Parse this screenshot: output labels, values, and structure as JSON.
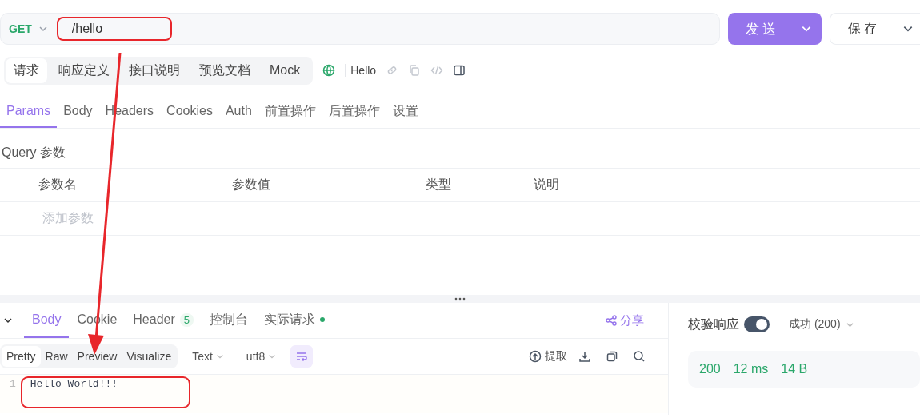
{
  "request": {
    "method": "GET",
    "url": "/hello",
    "send": "发送",
    "save": "保存"
  },
  "doc_tabs": [
    {
      "label": "请求",
      "selected": true
    },
    {
      "label": "响应定义",
      "selected": false
    },
    {
      "label": "接口说明",
      "selected": false
    },
    {
      "label": "预览文档",
      "selected": false
    },
    {
      "label": "Mock",
      "selected": false
    }
  ],
  "endpoint_name": "Hello",
  "param_tabs": [
    {
      "label": "Params",
      "selected": true
    },
    {
      "label": "Body",
      "selected": false
    },
    {
      "label": "Headers",
      "selected": false
    },
    {
      "label": "Cookies",
      "selected": false
    },
    {
      "label": "Auth",
      "selected": false
    },
    {
      "label": "前置操作",
      "selected": false
    },
    {
      "label": "后置操作",
      "selected": false
    },
    {
      "label": "设置",
      "selected": false
    }
  ],
  "query": {
    "title": "Query 参数",
    "columns": [
      "参数名",
      "参数值",
      "类型",
      "说明"
    ],
    "placeholder": "添加参数"
  },
  "response_tabs": [
    {
      "label": "Body",
      "selected": true
    },
    {
      "label": "Cookie",
      "selected": false
    },
    {
      "label": "Header",
      "selected": false,
      "badge": "5"
    },
    {
      "label": "控制台",
      "selected": false
    },
    {
      "label": "实际请求",
      "selected": false,
      "dot": true
    }
  ],
  "share": "分享",
  "formats": [
    {
      "label": "Pretty",
      "selected": true
    },
    {
      "label": "Raw",
      "selected": false
    },
    {
      "label": "Preview",
      "selected": false
    },
    {
      "label": "Visualize",
      "selected": false
    }
  ],
  "dropdowns": [
    "Text",
    "utf8"
  ],
  "wrap": true,
  "extract": "提取",
  "code_lines": [
    {
      "number": "1",
      "text": "Hello World!!!"
    }
  ],
  "validate": {
    "label": "校验响应",
    "on": true,
    "status": "成功 (200)"
  },
  "stats": [
    "200",
    "12 ms",
    "14 B"
  ]
}
